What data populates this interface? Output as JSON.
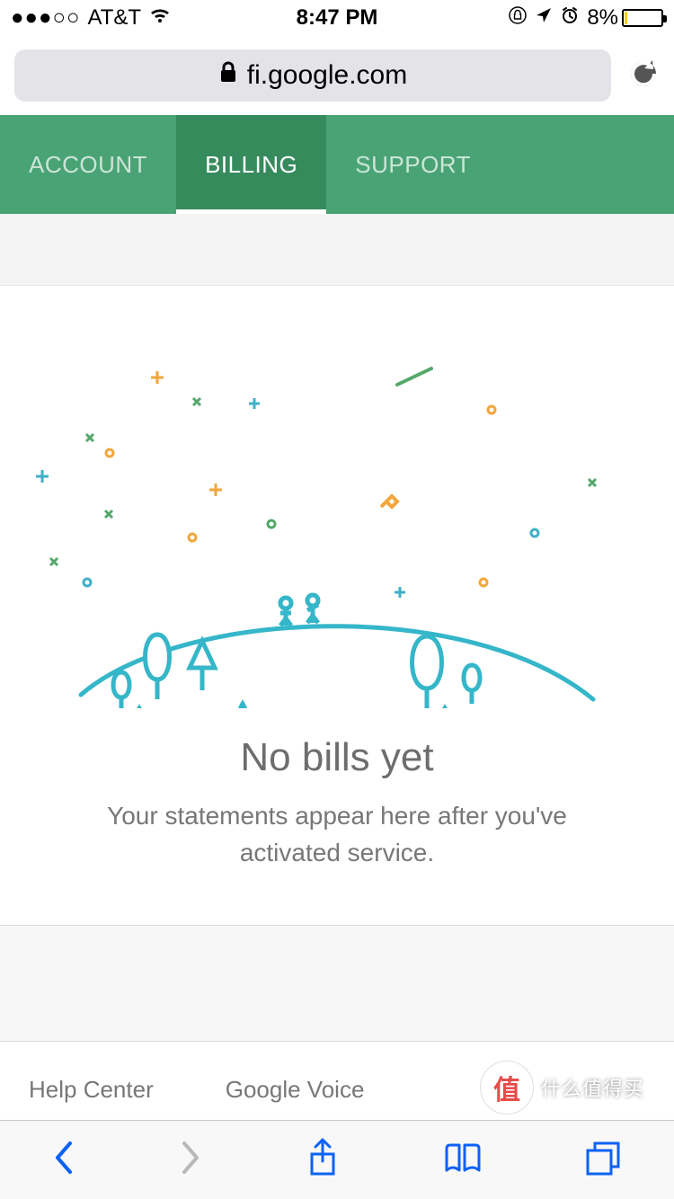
{
  "status": {
    "signal_dots": "●●●○○",
    "carrier": "AT&T",
    "time": "8:47 PM",
    "battery_pct": "8%"
  },
  "address_bar": {
    "host": "fi.google.com"
  },
  "tabs": [
    {
      "label": "ACCOUNT",
      "active": false
    },
    {
      "label": "BILLING",
      "active": true
    },
    {
      "label": "SUPPORT",
      "active": false
    }
  ],
  "empty_state": {
    "title": "No bills yet",
    "subtitle": "Your statements appear here after you've activated service."
  },
  "footer": {
    "links": [
      "Help Center",
      "Google Voice"
    ]
  },
  "watermark": {
    "badge": "值",
    "text": "什么值得买"
  }
}
